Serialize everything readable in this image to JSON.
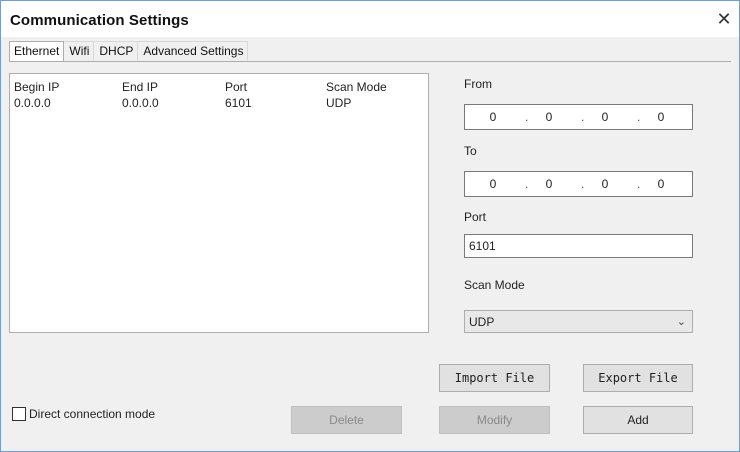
{
  "window": {
    "title": "Communication Settings",
    "close_glyph": "✕"
  },
  "tabs": [
    {
      "label": "Ethernet",
      "active": true
    },
    {
      "label": "Wifi",
      "active": false
    },
    {
      "label": "DHCP",
      "active": false
    },
    {
      "label": "Advanced Settings",
      "active": false
    }
  ],
  "list": {
    "columns": [
      "Begin IP",
      "End IP",
      "Port",
      "Scan Mode"
    ],
    "rows": [
      [
        "0.0.0.0",
        "0.0.0.0",
        "6101",
        "UDP"
      ]
    ]
  },
  "form": {
    "from_label": "From",
    "from_octets": [
      "0",
      "0",
      "0",
      "0"
    ],
    "to_label": "To",
    "to_octets": [
      "0",
      "0",
      "0",
      "0"
    ],
    "ip_separator": ".",
    "port_label": "Port",
    "port_value": "6101",
    "scan_mode_label": "Scan Mode",
    "scan_mode_value": "UDP",
    "scan_mode_icon": "chevron-down-icon",
    "chevron_glyph": "⌄"
  },
  "buttons": {
    "import": "Import File",
    "export": "Export File",
    "delete": "Delete",
    "modify": "Modify",
    "add": "Add"
  },
  "checkbox": {
    "label": "Direct connection mode",
    "checked": false
  },
  "colors": {
    "window_border": "#6aa0d8",
    "disabled_button": "#cccccc"
  }
}
